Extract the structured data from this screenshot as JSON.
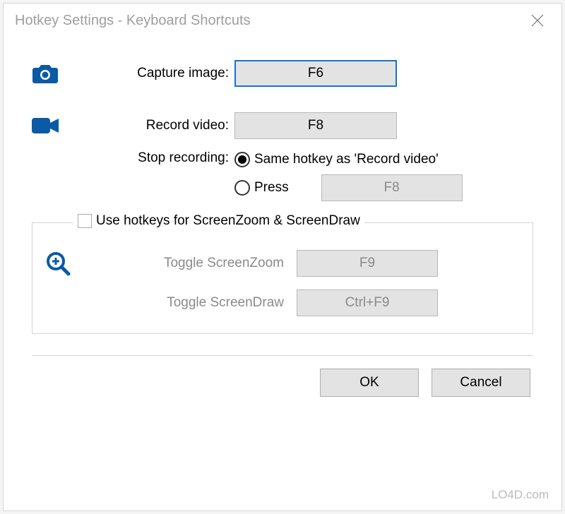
{
  "dialog": {
    "title": "Hotkey Settings - Keyboard Shortcuts"
  },
  "capture": {
    "label": "Capture image:",
    "hotkey": "F6"
  },
  "record": {
    "label": "Record video:",
    "hotkey": "F8"
  },
  "stop": {
    "label": "Stop recording:",
    "radio_same": "Same hotkey as 'Record video'",
    "radio_press": "Press",
    "press_hotkey": "F8"
  },
  "zoom_group": {
    "checkbox_label": "Use hotkeys for ScreenZoom & ScreenDraw",
    "screenzoom_label": "Toggle ScreenZoom",
    "screenzoom_hotkey": "F9",
    "screendraw_label": "Toggle ScreenDraw",
    "screendraw_hotkey": "Ctrl+F9"
  },
  "buttons": {
    "ok": "OK",
    "cancel": "Cancel"
  },
  "watermark": "LO4D.com"
}
